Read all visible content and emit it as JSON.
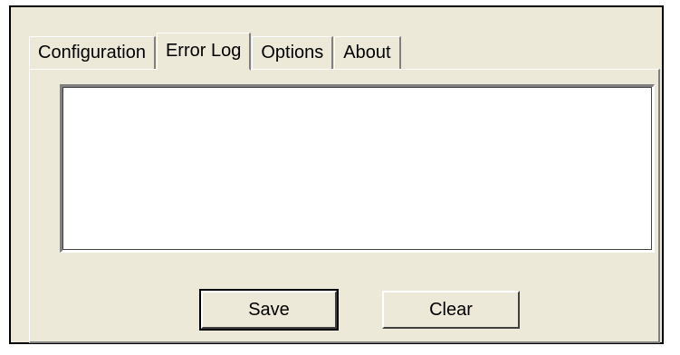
{
  "tabs": [
    {
      "label": "Configuration",
      "active": false
    },
    {
      "label": "Error Log",
      "active": true
    },
    {
      "label": "Options",
      "active": false
    },
    {
      "label": "About",
      "active": false
    }
  ],
  "error_log": {
    "content": ""
  },
  "buttons": {
    "save_label": "Save",
    "clear_label": "Clear"
  },
  "colors": {
    "dialog_background": "#ECE9D8",
    "text_area_background": "#FFFFFF"
  }
}
